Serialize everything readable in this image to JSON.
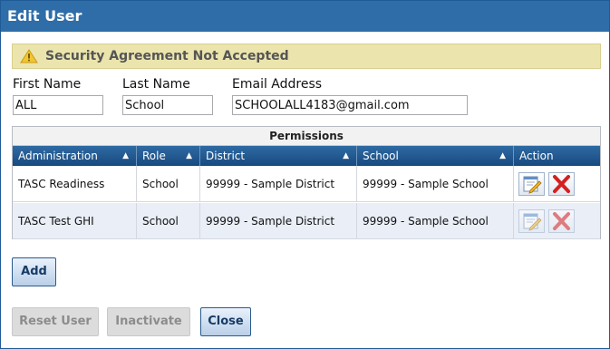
{
  "dialog": {
    "title": "Edit User"
  },
  "alert": {
    "message": "Security Agreement Not Accepted"
  },
  "form": {
    "first_name_label": "First Name",
    "first_name_value": "ALL",
    "last_name_label": "Last Name",
    "last_name_value": "School",
    "email_label": "Email Address",
    "email_value": "SCHOOLALL4183@gmail.com"
  },
  "permissions": {
    "caption": "Permissions",
    "columns": [
      "Administration",
      "Role",
      "District",
      "School",
      "Action"
    ],
    "rows": [
      {
        "administration": "TASC Readiness",
        "role": "School",
        "district": "99999 - Sample District",
        "school": "99999 - Sample School"
      },
      {
        "administration": "TASC Test GHI",
        "role": "School",
        "district": "99999 - Sample District",
        "school": "99999 - Sample School"
      }
    ]
  },
  "buttons": {
    "add": "Add",
    "reset_user": "Reset User",
    "inactivate": "Inactivate",
    "close": "Close"
  },
  "icons": {
    "alert": "warning-icon",
    "edit": "edit-icon",
    "delete": "delete-icon",
    "sort": "sort-asc-icon"
  },
  "colors": {
    "title_bar": "#2e6da8",
    "alert_bg": "#ebe5ad",
    "grid_header": "#1f5a8f",
    "delete_red": "#d42020"
  }
}
